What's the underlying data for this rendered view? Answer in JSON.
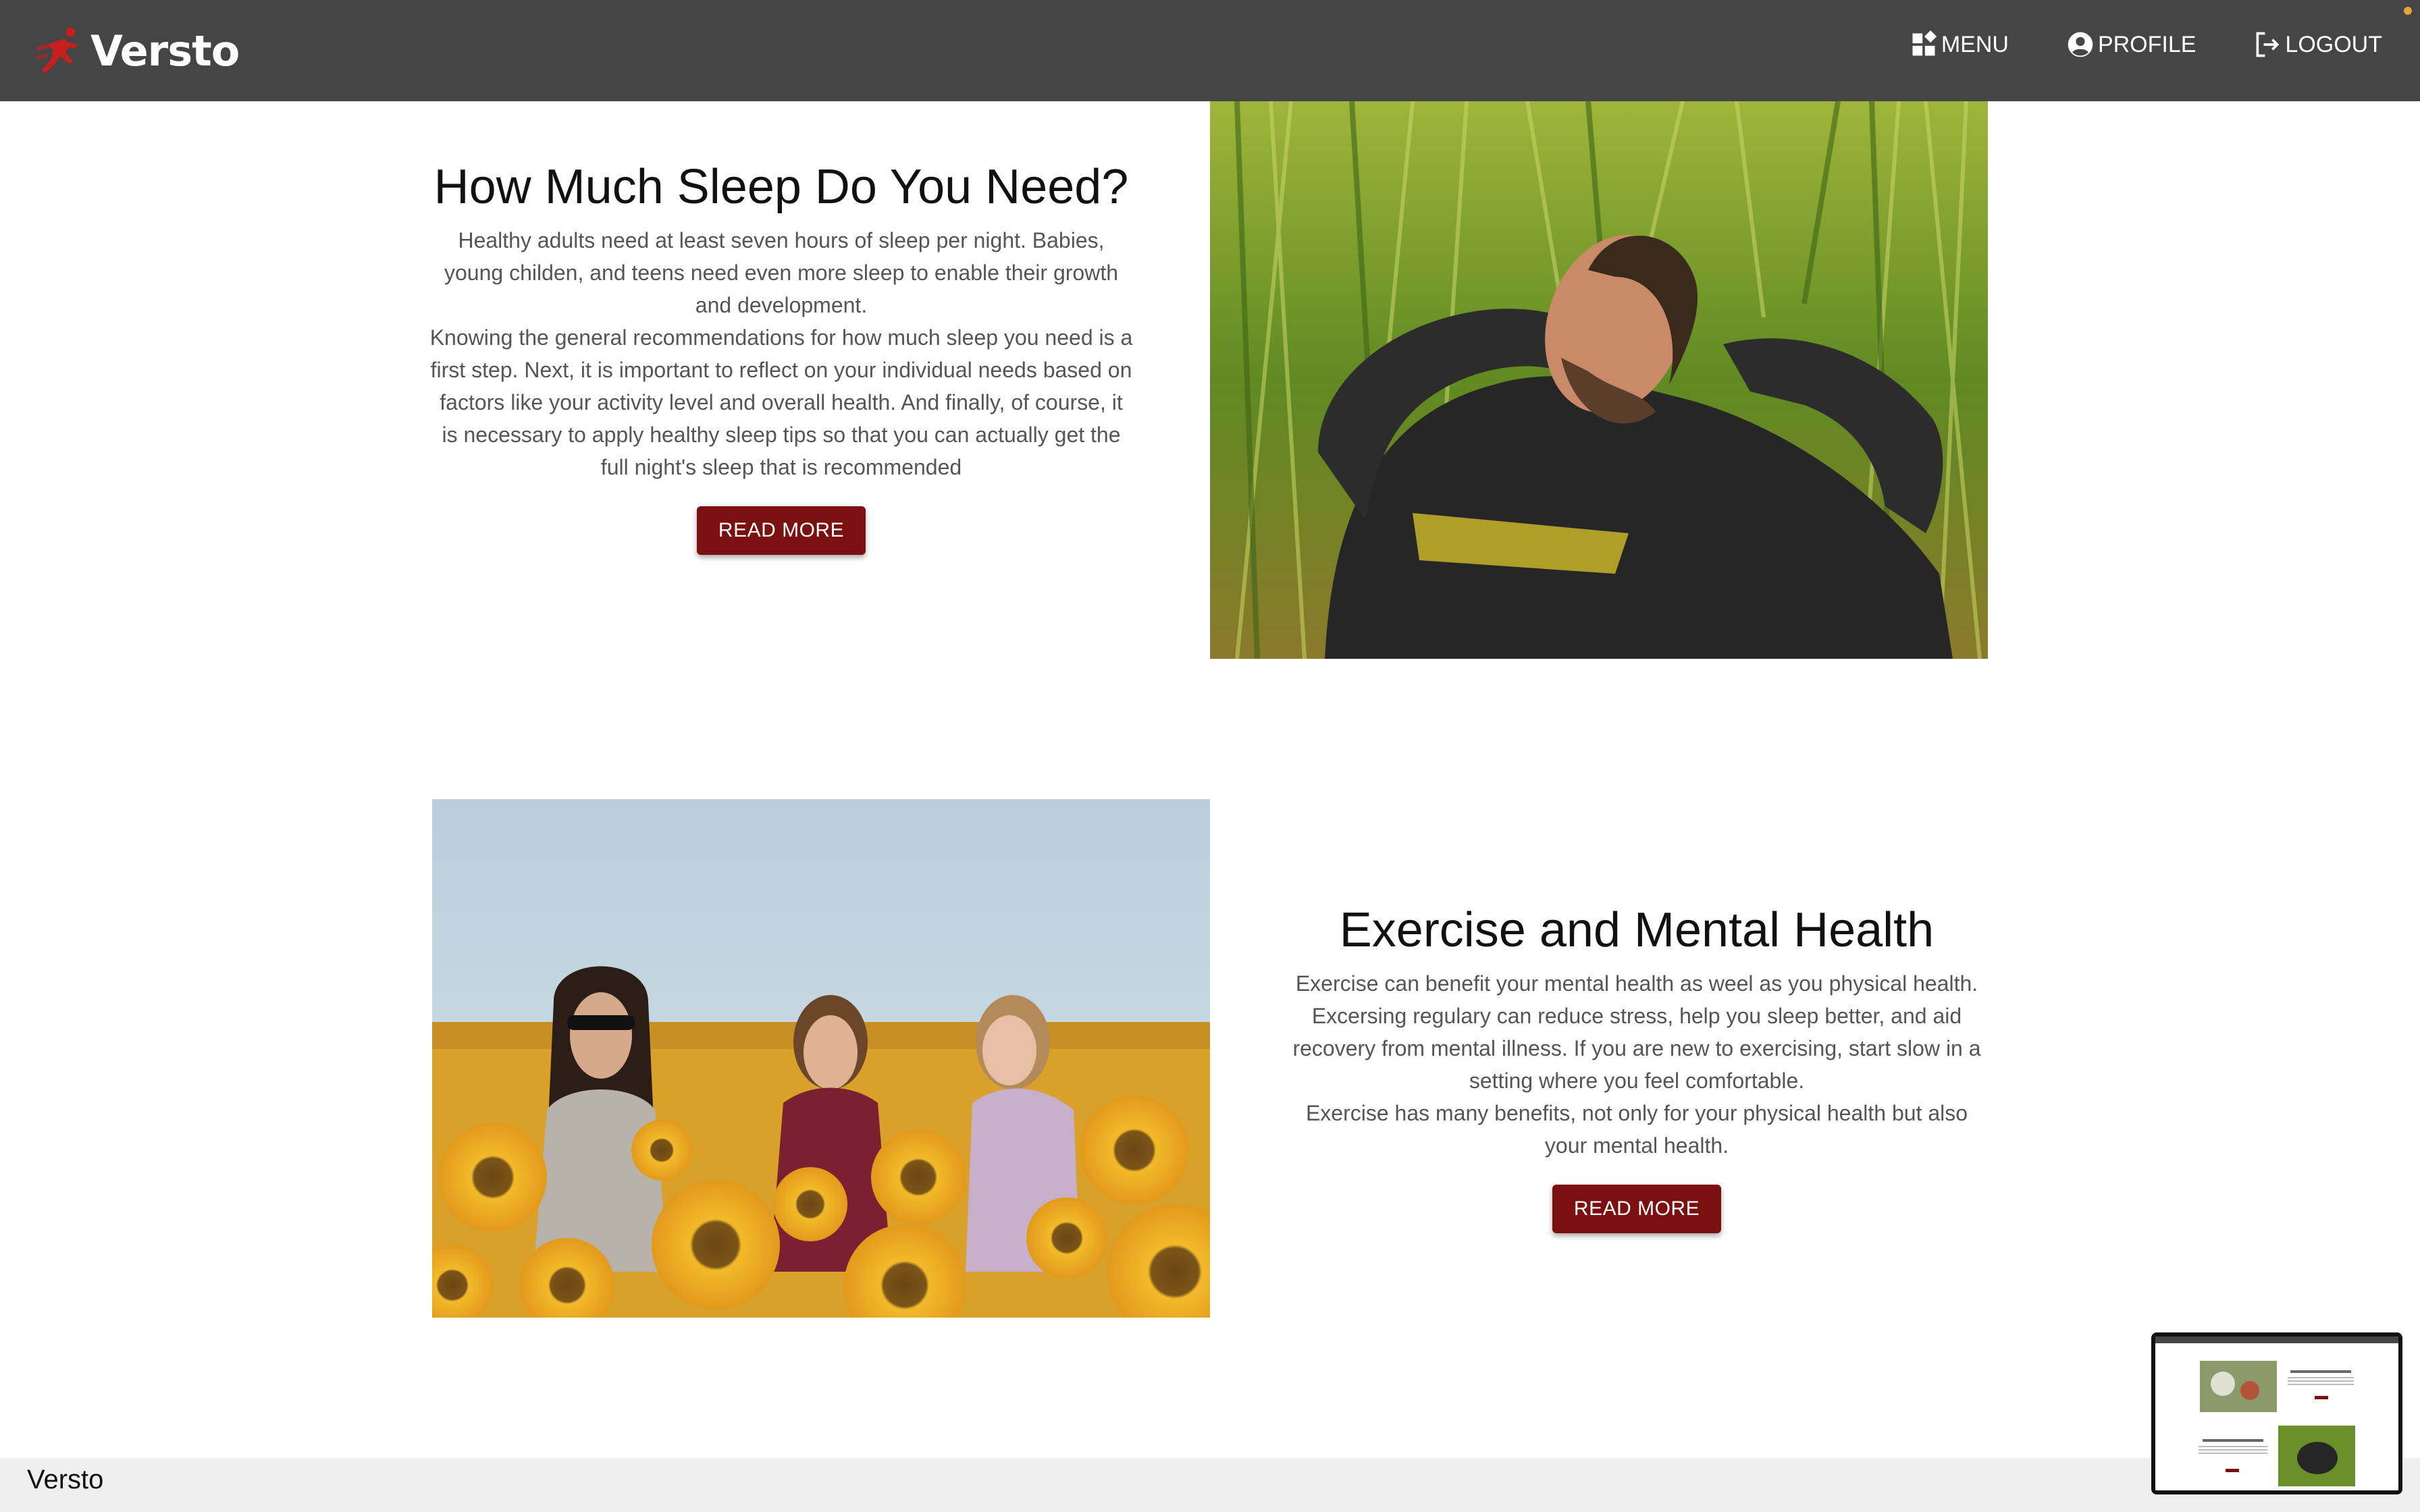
{
  "header": {
    "brand": "Versto",
    "nav": [
      {
        "label": "MENU",
        "icon": "menu-grid-icon"
      },
      {
        "label": "PROFILE",
        "icon": "user-circle-icon"
      },
      {
        "label": "LOGOUT",
        "icon": "logout-icon"
      }
    ]
  },
  "sections": [
    {
      "title": "How Much Sleep Do You Need?",
      "paragraphs": [
        "Healthy adults need at least seven hours of sleep per night. Babies, young childen, and teens need even more sleep to enable their growth and development.",
        "Knowing the general recommendations for how much sleep you need is a first step. Next, it is important to reflect on your individual needs based on factors like your activity level and overall health. And finally, of course, it is necessary to apply healthy sleep tips so that you can actually get the full night's sleep that is recommended"
      ],
      "button": "READ MORE"
    },
    {
      "title": "Exercise and Mental Health",
      "paragraphs": [
        "Exercise can benefit your mental health as weel as you physical health. Excersing regulary can reduce stress, help you sleep better, and aid recovery from mental illness. If you are new to exercising, start slow in a setting where you feel comfortable.",
        "Exercise has many benefits, not only for your physical health but also your mental health."
      ],
      "button": "READ MORE"
    }
  ],
  "footer": {
    "text": "Versto"
  },
  "colors": {
    "header_bg": "#454545",
    "button_bg": "#7a1010",
    "footer_bg": "#efefef",
    "logo_red": "#c81e1e"
  }
}
